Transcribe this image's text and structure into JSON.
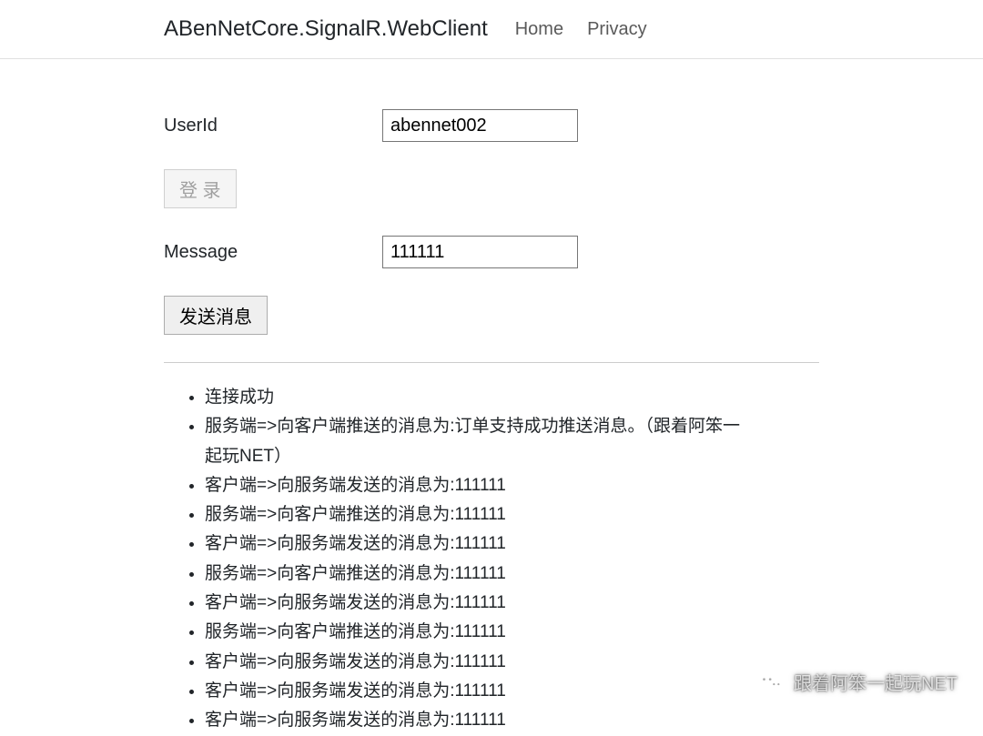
{
  "navbar": {
    "brand": "ABenNetCore.SignalR.WebClient",
    "links": [
      {
        "label": "Home"
      },
      {
        "label": "Privacy"
      }
    ]
  },
  "form": {
    "userid_label": "UserId",
    "userid_value": "abennet002",
    "login_button": "登 录",
    "message_label": "Message",
    "message_value": "111111",
    "send_button": "发送消息"
  },
  "messages": [
    "连接成功",
    "服务端=>向客户端推送的消息为:订单支持成功推送消息。（跟着阿笨一起玩NET）",
    "客户端=>向服务端发送的消息为:111111",
    "服务端=>向客户端推送的消息为:111111",
    "客户端=>向服务端发送的消息为:111111",
    "服务端=>向客户端推送的消息为:111111",
    "客户端=>向服务端发送的消息为:111111",
    "服务端=>向客户端推送的消息为:111111",
    "客户端=>向服务端发送的消息为:111111",
    "客户端=>向服务端发送的消息为:111111",
    "客户端=>向服务端发送的消息为:111111"
  ],
  "watermark": {
    "text": "跟着阿笨一起玩NET"
  }
}
